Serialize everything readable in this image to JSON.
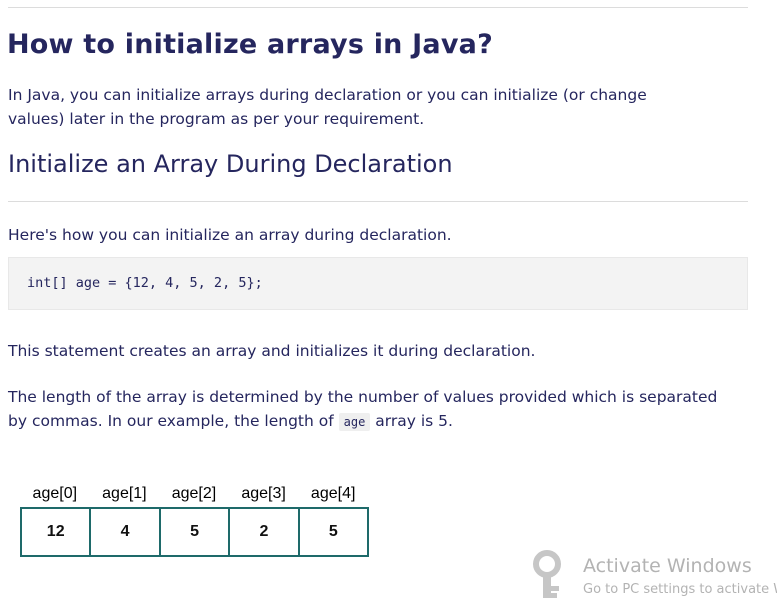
{
  "article": {
    "title": "How to initialize arrays in Java?",
    "intro_line1": "In Java, you can initialize arrays during declaration or you can initialize (or change",
    "intro_line2": "values) later in the program as per your requirement.",
    "section_heading": "Initialize an Array During Declaration",
    "lead_text": "Here's how you can initialize an array during declaration.",
    "code": "int[] age = {12, 4, 5, 2, 5};",
    "statement_text": "This statement creates an array and initializes it during declaration.",
    "length_line1": "The length of the array is determined by the number of values provided which is separated",
    "length_line2_before": "by commas. In our example, the length of",
    "length_inline_code": "age",
    "length_line2_after": "array is 5."
  },
  "array_diagram": {
    "labels": [
      "age[0]",
      "age[1]",
      "age[2]",
      "age[3]",
      "age[4]"
    ],
    "values": [
      "12",
      "4",
      "5",
      "2",
      "5"
    ]
  },
  "watermark": {
    "title": "Activate Windows",
    "subtitle": "Go to PC settings to activate W",
    "icon": "key-icon"
  },
  "colors": {
    "text": "#25265e",
    "code_bg": "#f3f3f3",
    "array_border": "#1e6a6a",
    "watermark": "#b3b3b3"
  }
}
